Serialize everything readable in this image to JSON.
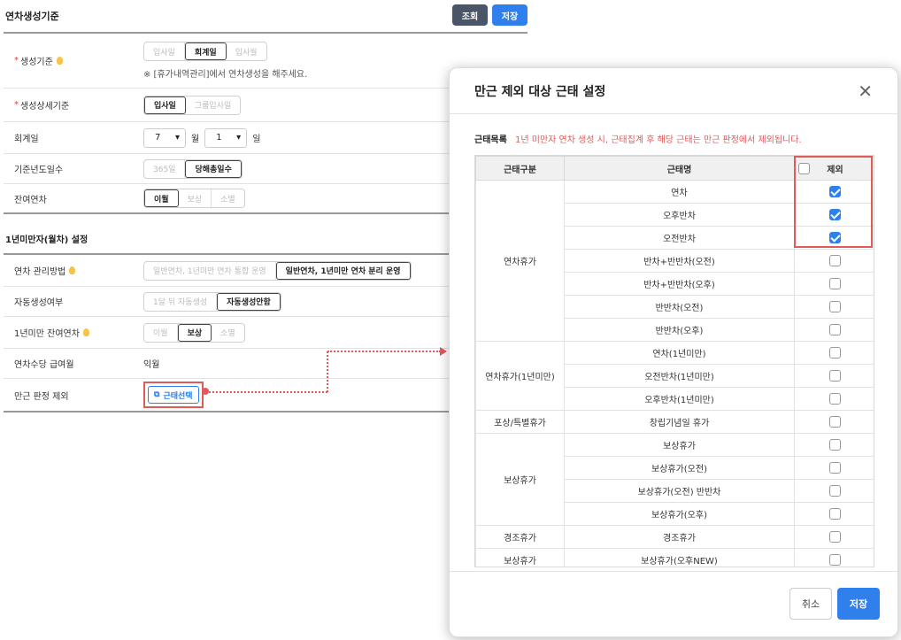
{
  "page": {
    "title": "연차생성기준",
    "search_button": "조회",
    "save_button": "저장"
  },
  "settings": {
    "rows": [
      {
        "label": "생성기준",
        "required": true,
        "options": [
          "입사일",
          "회계일",
          "입사월"
        ],
        "selected": "회계일",
        "hint": "※ [휴가내역관리]에서 연차생성을 해주세요."
      },
      {
        "label": "생성상세기준",
        "required": true,
        "options": [
          "입사일",
          "그룹입사일"
        ],
        "selected": "입사일"
      },
      {
        "label": "회계일",
        "month_value": "7",
        "month_unit": "월",
        "day_value": "1",
        "day_unit": "일"
      },
      {
        "label": "기준년도일수",
        "options": [
          "365일",
          "당해총일수"
        ],
        "selected": "당해총일수"
      },
      {
        "label": "잔여연차",
        "options": [
          "이월",
          "보상",
          "소멸"
        ],
        "selected": "이월"
      }
    ]
  },
  "section2": {
    "title": "1년미만자(월차) 설정",
    "rows": [
      {
        "label": "연차 관리방법",
        "options": [
          "일반연차, 1년미만 연차 통합 운영",
          "일반연차, 1년미만 연차 분리 운영"
        ],
        "selected": "일반연차, 1년미만 연차 분리 운영"
      },
      {
        "label": "자동생성여부",
        "options": [
          "1달 뒤 자동생성",
          "자동생성안함"
        ],
        "selected": "자동생성안함"
      },
      {
        "label": "1년미만 잔여연차",
        "options": [
          "이월",
          "보상",
          "소멸"
        ],
        "selected": "보상"
      },
      {
        "label": "연차수당 급여월",
        "value": "익월"
      },
      {
        "label": "만근 판정 제외",
        "button": "근태선택"
      }
    ]
  },
  "modal": {
    "title": "만근 제외 대상 근태 설정",
    "list_title": "근태목록",
    "warning": "1년 미만자 연차 생성 시, 근태집계 후 해당 근태는 만근 판정에서 제외됩니다.",
    "columns": [
      "근태구분",
      "근태명",
      "제외"
    ],
    "groups": [
      {
        "name": "연차휴가",
        "items": [
          {
            "name": "연차",
            "checked": true
          },
          {
            "name": "오후반차",
            "checked": true
          },
          {
            "name": "오전반차",
            "checked": true
          },
          {
            "name": "반차+반반차(오전)",
            "checked": false
          },
          {
            "name": "반차+반반차(오후)",
            "checked": false
          },
          {
            "name": "반반차(오전)",
            "checked": false
          },
          {
            "name": "반반차(오후)",
            "checked": false
          }
        ]
      },
      {
        "name": "연차휴가(1년미만)",
        "items": [
          {
            "name": "연차(1년미만)",
            "checked": false
          },
          {
            "name": "오전반차(1년미만)",
            "checked": false
          },
          {
            "name": "오후반차(1년미만)",
            "checked": false
          }
        ]
      },
      {
        "name": "포상/특별휴가",
        "items": [
          {
            "name": "창립기념일 휴가",
            "checked": false
          }
        ]
      },
      {
        "name": "보상휴가",
        "items": [
          {
            "name": "보상휴가",
            "checked": false
          },
          {
            "name": "보상휴가(오전)",
            "checked": false
          },
          {
            "name": "보상휴가(오전) 반반차",
            "checked": false
          },
          {
            "name": "보상휴가(오후)",
            "checked": false
          }
        ]
      },
      {
        "name": "경조휴가",
        "items": [
          {
            "name": "경조휴가",
            "checked": false
          }
        ]
      },
      {
        "name": "보상휴가",
        "items": [
          {
            "name": "보상휴가(오후NEW)",
            "checked": false
          }
        ]
      }
    ],
    "cancel": "취소",
    "save": "저장"
  },
  "colors": {
    "accent": "#2f80ed",
    "highlight": "#e05a5a"
  }
}
